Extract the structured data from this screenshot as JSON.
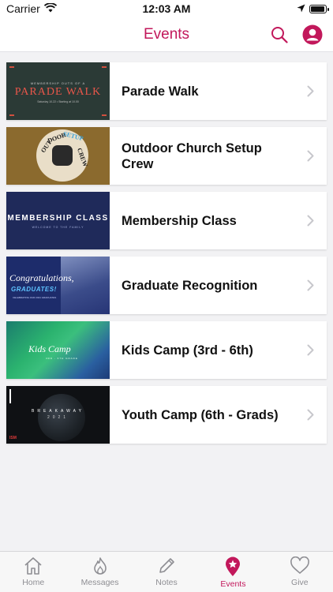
{
  "status": {
    "carrier": "Carrier",
    "time": "12:03 AM",
    "battery_level": 0.95
  },
  "header": {
    "title": "Events"
  },
  "colors": {
    "accent": "#c2185b",
    "chevron": "#c7c7cc",
    "tab_inactive": "#8e8e93"
  },
  "events": [
    {
      "title": "Parade Walk",
      "thumb": {
        "small": "MEMBERSHIP OUTS OF A",
        "big": "PARADE WALK",
        "sub": "Saturday 10.22 • Starting at 10.00"
      }
    },
    {
      "title": "Outdoor Church Setup Crew",
      "thumb": {
        "word1": "OUT",
        "word2": "DOOR",
        "word3": "SETUP",
        "word4": "CREW"
      }
    },
    {
      "title": "Membership Class",
      "thumb": {
        "big": "MEMBERSHIP CLASS",
        "sub": "WELCOME TO THE FAMILY"
      }
    },
    {
      "title": "Graduate Recognition",
      "thumb": {
        "script": "Congratulations,",
        "grad": "GRADUATES!",
        "sub": "CELEBRATING OUR 2021 GRADUATES"
      }
    },
    {
      "title": "Kids Camp (3rd - 6th)",
      "thumb": {
        "script": "Kids Camp",
        "sub": "3RD - 6TH GRADE"
      }
    },
    {
      "title": "Youth Camp (6th - Grads)",
      "thumb": {
        "big": "BREAKAWAY",
        "year": "2021",
        "brand": "ISM"
      }
    }
  ],
  "tabs": [
    {
      "label": "Home",
      "icon": "home-icon"
    },
    {
      "label": "Messages",
      "icon": "flame-icon"
    },
    {
      "label": "Notes",
      "icon": "pencil-icon"
    },
    {
      "label": "Events",
      "icon": "events-star-icon",
      "active": true
    },
    {
      "label": "Give",
      "icon": "heart-icon"
    }
  ]
}
